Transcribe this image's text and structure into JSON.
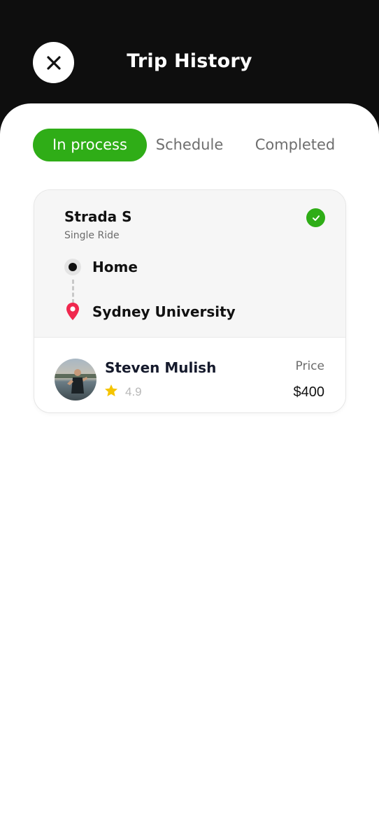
{
  "header": {
    "title": "Trip History",
    "close_icon": "close-icon",
    "background": "#0e0e0e"
  },
  "tabs": [
    {
      "label": "In process",
      "active": true
    },
    {
      "label": "Schedule",
      "active": false
    },
    {
      "label": "Completed",
      "active": false
    }
  ],
  "accent_color": "#2fad17",
  "trip": {
    "car_name": "Strada S",
    "ride_type": "Single Ride",
    "status_icon": "check-circle-icon",
    "origin": "Home",
    "destination": "Sydney University",
    "driver": {
      "name": "Steven Mulish",
      "rating": "4.9",
      "star_color": "#f5c400"
    },
    "price_label": "Price",
    "price": "$400"
  }
}
